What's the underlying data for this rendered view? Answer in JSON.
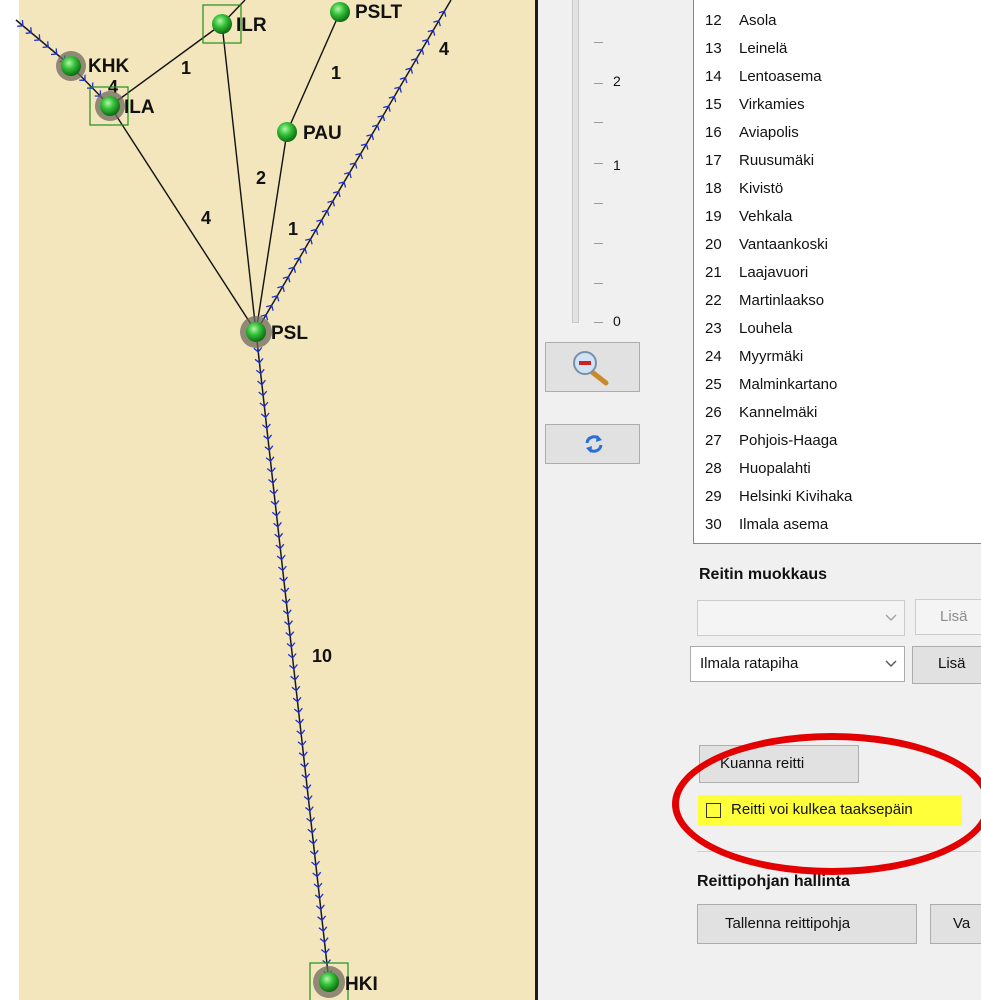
{
  "map": {
    "stations": [
      {
        "code": "KHK"
      },
      {
        "code": "ILA"
      },
      {
        "code": "ILR"
      },
      {
        "code": "PSLT"
      },
      {
        "code": "PAU"
      },
      {
        "code": "PSL"
      },
      {
        "code": "HKI"
      }
    ],
    "segment_labels": [
      "1",
      "1",
      "4",
      "4",
      "2",
      "4",
      "1",
      "10"
    ],
    "colors": {
      "background": "#f3e5bc",
      "station": "#2ec02e",
      "route": "#1a2fd6",
      "annotation": "#e30000",
      "highlight": "#ffff3a"
    }
  },
  "zoom": {
    "labels": [
      "2",
      "1",
      "0"
    ],
    "zoom_out_icon": "zoom-out-magnifier-icon",
    "refresh_icon": "refresh-arrows-icon"
  },
  "route_list": {
    "rows": [
      {
        "num": "12",
        "name": "Asola"
      },
      {
        "num": "13",
        "name": "Leinelä"
      },
      {
        "num": "14",
        "name": "Lentoasema"
      },
      {
        "num": "15",
        "name": "Virkamies"
      },
      {
        "num": "16",
        "name": "Aviapolis"
      },
      {
        "num": "17",
        "name": "Ruusumäki"
      },
      {
        "num": "18",
        "name": "Kivistö"
      },
      {
        "num": "19",
        "name": "Vehkala"
      },
      {
        "num": "20",
        "name": "Vantaankoski"
      },
      {
        "num": "21",
        "name": "Laajavuori"
      },
      {
        "num": "22",
        "name": "Martinlaakso"
      },
      {
        "num": "23",
        "name": "Louhela"
      },
      {
        "num": "24",
        "name": "Myyrmäki"
      },
      {
        "num": "25",
        "name": "Malminkartano"
      },
      {
        "num": "26",
        "name": "Kannelmäki"
      },
      {
        "num": "27",
        "name": "Pohjois-Haaga"
      },
      {
        "num": "28",
        "name": "Huopalahti"
      },
      {
        "num": "29",
        "name": "Helsinki Kivihaka"
      },
      {
        "num": "30",
        "name": "Ilmala asema"
      }
    ]
  },
  "route_edit": {
    "title": "Reitin muokkaus",
    "combo1_value": "",
    "add1_label": "Lisä",
    "combo2_value": "Ilmala ratapiha",
    "add2_label": "Lisä",
    "draw_route_label": "Kuanna reitti",
    "backwards_checkbox_label": "Reitti voi kulkea taaksepäin",
    "backwards_checked": false
  },
  "template_mgmt": {
    "title": "Reittipohjan hallinta",
    "save_label": "Tallenna reittipohja",
    "second_label": "Va"
  }
}
